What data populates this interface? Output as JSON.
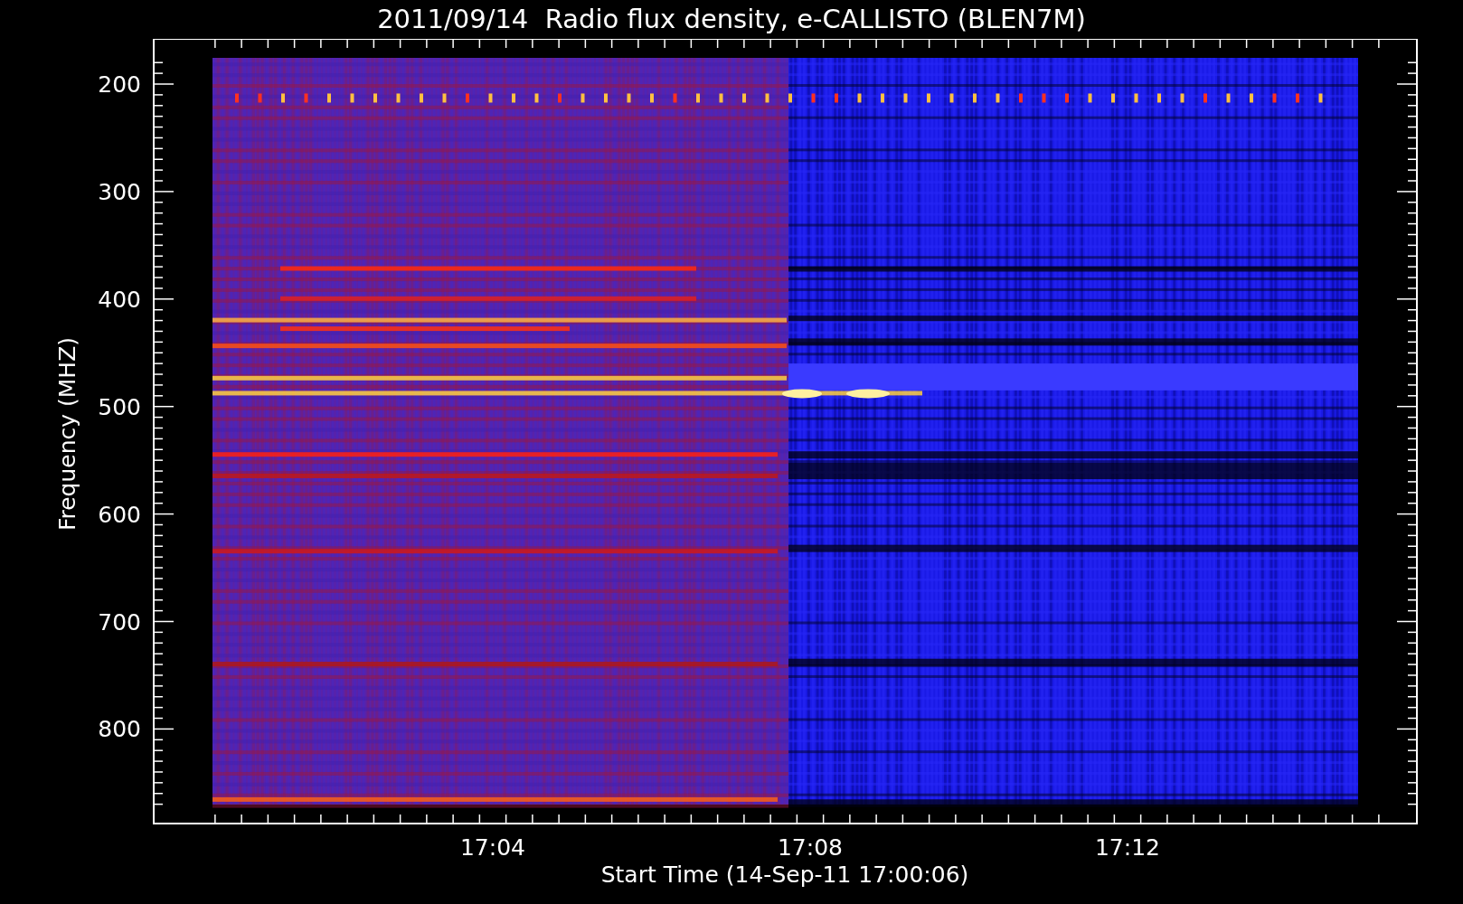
{
  "title": "2011/09/14  Radio flux density, e-CALLISTO (BLEN7M)",
  "y_axis": {
    "label": "Frequency (MHZ)",
    "ticks": [
      "200",
      "300",
      "400",
      "500",
      "600",
      "700",
      "800"
    ]
  },
  "x_axis": {
    "label": "Start Time (14-Sep-11 17:00:06)",
    "ticks": [
      "17:04",
      "17:08",
      "17:12"
    ]
  }
}
